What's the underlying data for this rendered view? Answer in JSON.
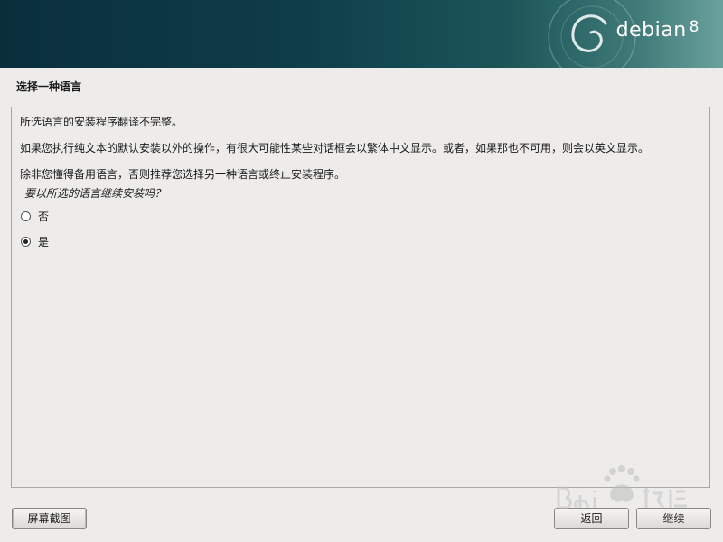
{
  "banner": {
    "brand": "debian",
    "version": "8"
  },
  "dialog": {
    "title": "选择一种语言",
    "paragraphs": [
      "所选语言的安装程序翻译不完整。",
      "如果您执行纯文本的默认安装以外的操作，有很大可能性某些对话框会以繁体中文显示。或者，如果那也不可用，则会以英文显示。",
      "除非您懂得备用语言，否则推荐您选择另一种语言或终止安装程序。"
    ],
    "question": "要以所选的语言继续安装吗？",
    "options": [
      {
        "label": "否",
        "selected": false
      },
      {
        "label": "是",
        "selected": true
      }
    ]
  },
  "buttons": {
    "screenshot": "屏幕截图",
    "back": "返回",
    "continue": "继续"
  },
  "colors": {
    "banner_dark": "#0a2f3c",
    "banner_light": "#6aa19c",
    "background": "#edeceb",
    "border": "#a9a9a4"
  },
  "icons": {
    "debian_swirl": "debian-swirl-logo",
    "watermark": "baidu-paw-logo"
  }
}
